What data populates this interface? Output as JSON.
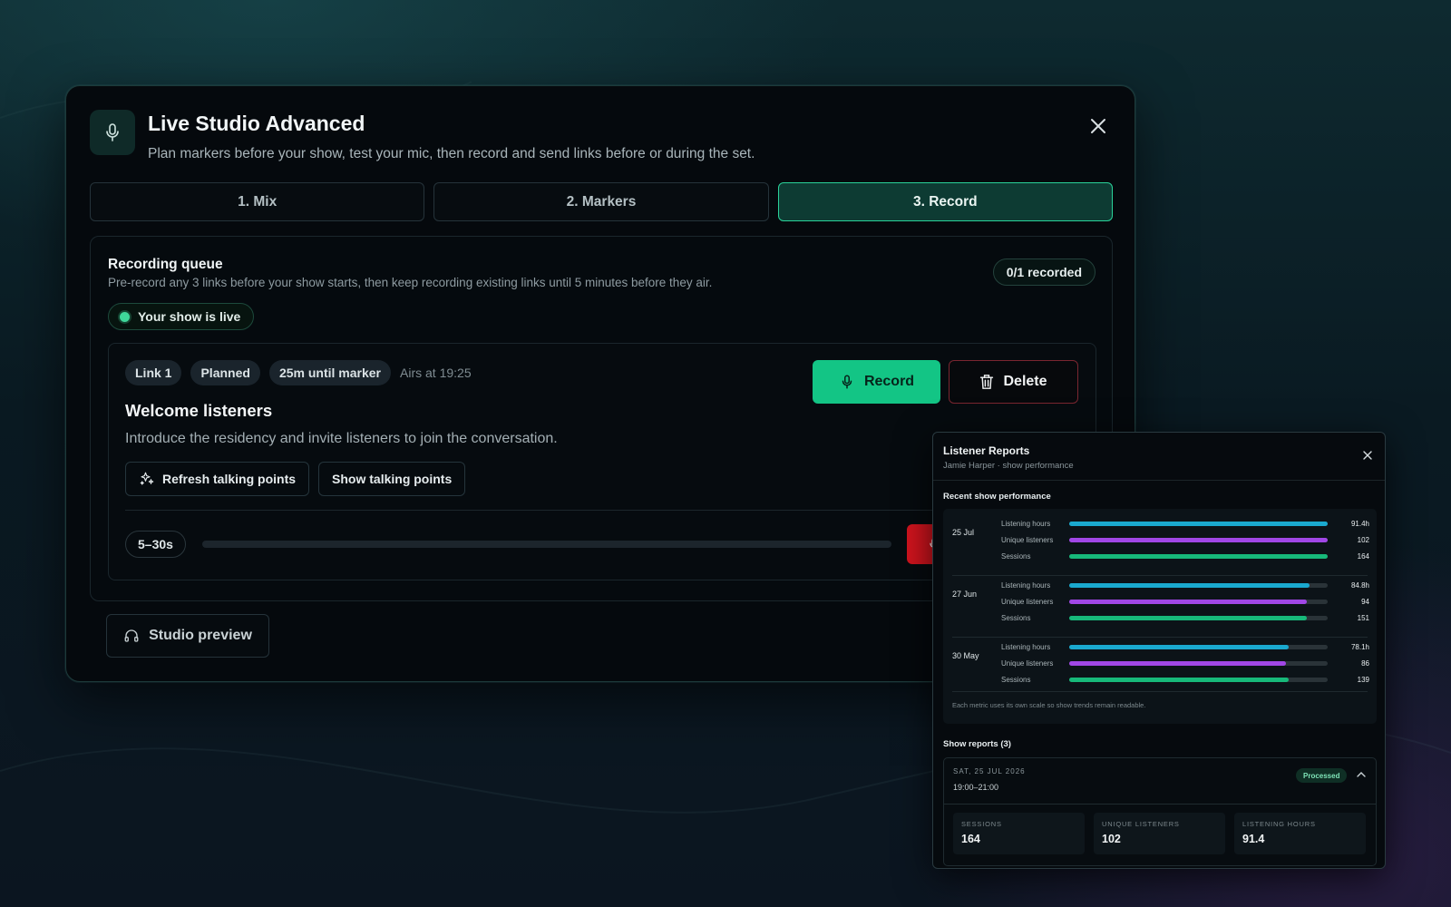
{
  "window": {
    "title": "Live Studio Advanced",
    "subtitle": "Plan markers before your show, test your mic, then record and send links before or during the set.",
    "icon": "microphone-icon"
  },
  "tabs": [
    {
      "label": "1. Mix",
      "active": false
    },
    {
      "label": "2. Markers",
      "active": false
    },
    {
      "label": "3. Record",
      "active": true
    }
  ],
  "queue": {
    "title": "Recording queue",
    "subtitle": "Pre-record any 3 links before your show starts, then keep recording existing links until 5 minutes before they air.",
    "count": "0/1 recorded",
    "live_label": "Your show is live"
  },
  "link": {
    "chips": [
      "Link 1",
      "Planned",
      "25m until marker"
    ],
    "airs": "Airs at 19:25",
    "title": "Welcome listeners",
    "description": "Introduce the residency and invite listeners to join the conversation.",
    "refresh_label": "Refresh talking points",
    "show_label": "Show talking points",
    "record_label": "Record",
    "delete_label": "Delete",
    "duration": "5–30s",
    "progress": 0
  },
  "footer": {
    "preview_label": "Studio preview"
  },
  "colors": {
    "accent": "#13c585",
    "danger": "#d3141e",
    "listening_hours": "#1aa9cf",
    "unique_listeners": "#a147e6",
    "sessions": "#17b97a"
  },
  "reports": {
    "title": "Listener Reports",
    "subtitle": "Jamie Harper · show performance",
    "recent_heading": "Recent show performance",
    "groups": [
      {
        "date": "25 Jul",
        "rows": [
          {
            "label": "Listening hours",
            "value": "91.4h",
            "fraction": 1.0
          },
          {
            "label": "Unique listeners",
            "value": "102",
            "fraction": 1.0
          },
          {
            "label": "Sessions",
            "value": "164",
            "fraction": 1.0
          }
        ]
      },
      {
        "date": "27 Jun",
        "rows": [
          {
            "label": "Listening hours",
            "value": "84.8h",
            "fraction": 0.93
          },
          {
            "label": "Unique listeners",
            "value": "94",
            "fraction": 0.92
          },
          {
            "label": "Sessions",
            "value": "151",
            "fraction": 0.92
          }
        ]
      },
      {
        "date": "30 May",
        "rows": [
          {
            "label": "Listening hours",
            "value": "78.1h",
            "fraction": 0.85
          },
          {
            "label": "Unique listeners",
            "value": "86",
            "fraction": 0.84
          },
          {
            "label": "Sessions",
            "value": "139",
            "fraction": 0.85
          }
        ]
      }
    ],
    "note": "Each metric uses its own scale so show trends remain readable.",
    "show_reports_heading": "Show reports (3)",
    "report": {
      "date": "SAT, 25 JUL 2026",
      "time": "19:00–21:00",
      "status": "Processed",
      "stats": [
        {
          "label": "SESSIONS",
          "value": "164"
        },
        {
          "label": "UNIQUE LISTENERS",
          "value": "102"
        },
        {
          "label": "LISTENING HOURS",
          "value": "91.4"
        }
      ]
    }
  }
}
